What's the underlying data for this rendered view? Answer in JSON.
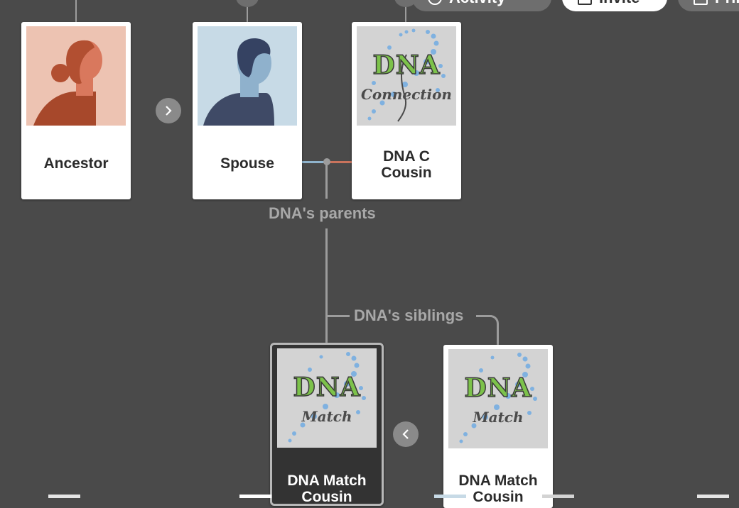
{
  "toolbar": {
    "activity_label": "Activity",
    "invite_label": "Invite",
    "more_label": "Print"
  },
  "parents_row": [
    {
      "name": "Ancestor",
      "avatar": "female-silhouette-icon"
    },
    {
      "name": "Spouse",
      "avatar": "male-silhouette-icon"
    },
    {
      "name": "DNA C\nCousin",
      "image_word": "DNA",
      "image_sub": "Connection"
    }
  ],
  "labels": {
    "parents": "DNA's parents",
    "siblings": "DNA's siblings"
  },
  "siblings_row": [
    {
      "name": "DNA Match\nCousin",
      "image_word": "DNA",
      "image_sub": "Match",
      "selected": true
    },
    {
      "name": "DNA Match\nCousin",
      "image_word": "DNA",
      "image_sub": "Match",
      "selected": false
    }
  ],
  "nav": {
    "next_icon": "chevron-right-icon",
    "prev_icon": "chevron-left-icon"
  },
  "colors": {
    "background": "#4a4a4a",
    "father_line": "#8fb3cc",
    "mother_line": "#c9735c",
    "dna_green": "#7cc24a"
  }
}
